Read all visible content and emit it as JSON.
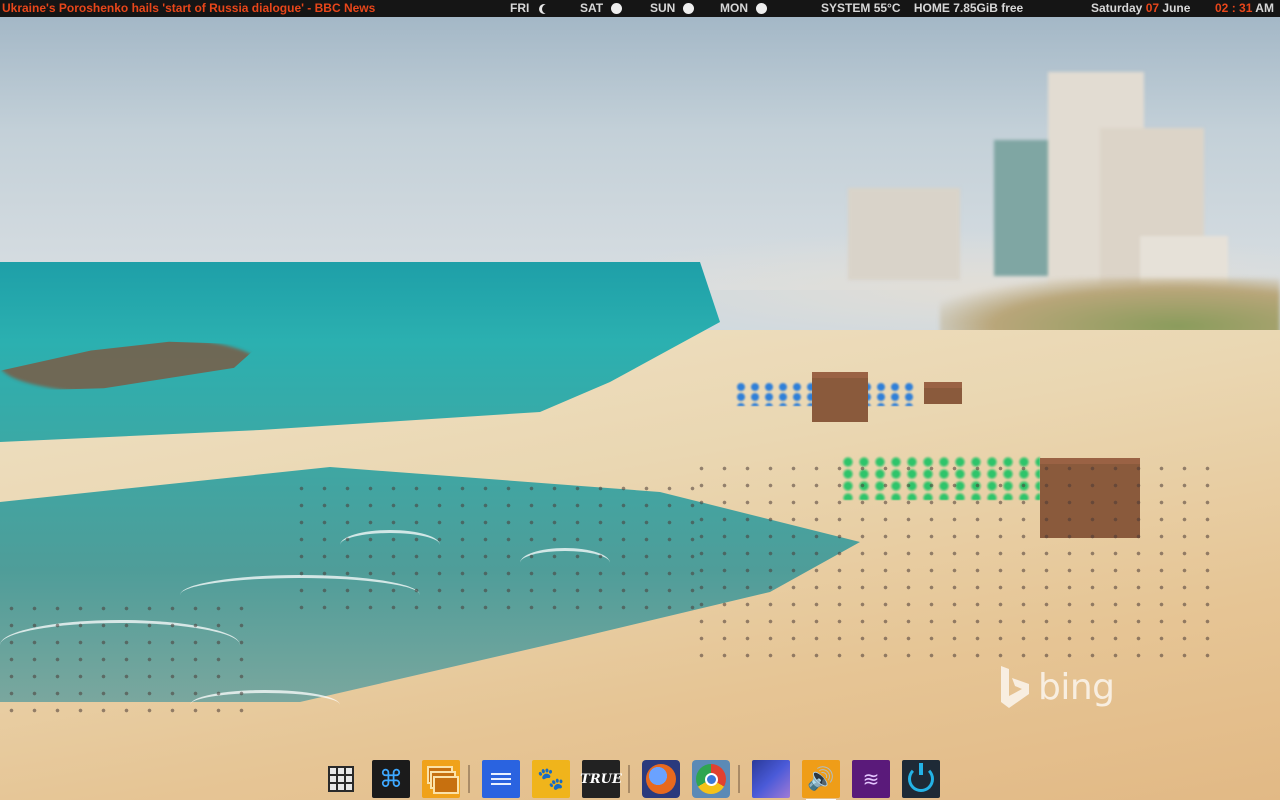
{
  "top_panel": {
    "news_headline": "Ukraine's Poroshenko hails 'start of Russia dialogue' - BBC News",
    "forecast": [
      {
        "day": "FRI",
        "icon": "moon-icon"
      },
      {
        "day": "SAT",
        "icon": "sun-icon"
      },
      {
        "day": "SUN",
        "icon": "sun-icon"
      },
      {
        "day": "MON",
        "icon": "sun-icon"
      }
    ],
    "system_label": "SYSTEM",
    "system_temp": "55°C",
    "home_label": "HOME",
    "home_free": "7.85GiB free",
    "date_weekday": "Saturday",
    "date_day": "07",
    "date_month": "June",
    "clock_hour": "02",
    "clock_sep": ":",
    "clock_minute": "31",
    "clock_ampm": "AM",
    "accent_color": "#e8461a"
  },
  "wallpaper": {
    "watermark": "bing"
  },
  "dock": {
    "items": [
      {
        "name": "app-grid",
        "icon": "grid-icon"
      },
      {
        "name": "command-launcher",
        "icon": "command-icon",
        "glyph": "⌘"
      },
      {
        "name": "file-stack",
        "icon": "stack-icon"
      },
      {
        "name": "text-document",
        "icon": "document-icon"
      },
      {
        "name": "gimp",
        "icon": "gimp-icon",
        "glyph": "🐾"
      },
      {
        "name": "true-app",
        "icon": "true-icon",
        "glyph": "TRUE"
      },
      {
        "name": "firefox",
        "icon": "firefox-icon"
      },
      {
        "name": "chrome",
        "icon": "chrome-icon"
      },
      {
        "name": "workspace-switcher",
        "icon": "screen-icon"
      },
      {
        "name": "sound",
        "icon": "speaker-icon",
        "glyph": "🔊"
      },
      {
        "name": "wifi",
        "icon": "wifi-icon",
        "glyph": "≋"
      },
      {
        "name": "power",
        "icon": "power-icon"
      }
    ]
  }
}
